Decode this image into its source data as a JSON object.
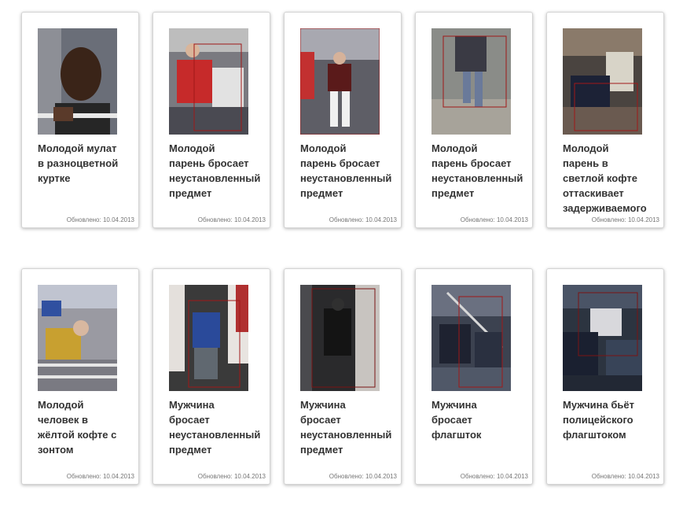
{
  "updated_prefix": "Обновлено: ",
  "cards": [
    {
      "caption": "Молодой мулат\nв разноцветной\nкуртке",
      "date": "10.04.2013"
    },
    {
      "caption": "Молодой\nпарень бросает\nнеустановленный\nпредмет",
      "date": "10.04.2013"
    },
    {
      "caption": "Молодой\nпарень бросает\nнеустановленный\nпредмет",
      "date": "10.04.2013"
    },
    {
      "caption": "Молодой\nпарень бросает\nнеустановленный\nпредмет",
      "date": "10.04.2013"
    },
    {
      "caption": "Молодой\nпарень в\nсветлой кофте\nоттаскивает\nзадерживаемого",
      "date": "10.04.2013"
    },
    {
      "caption": "Молодой\nчеловек в\nжёлтой кофте с\nзонтом",
      "date": "10.04.2013"
    },
    {
      "caption": "Мужчина\nбросает\nнеустановленный\nпредмет",
      "date": "10.04.2013"
    },
    {
      "caption": "Мужчина\nбросает\nнеустановленный\nпредмет",
      "date": "10.04.2013"
    },
    {
      "caption": "Мужчина\nбросает\nфлагшток",
      "date": "10.04.2013"
    },
    {
      "caption": "Мужчина бьёт\nполицейского\nфлагштоком",
      "date": "10.04.2013"
    }
  ]
}
